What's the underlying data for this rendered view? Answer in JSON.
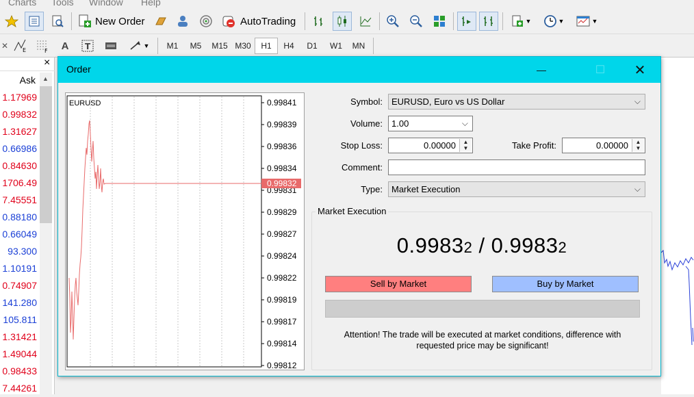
{
  "menu": {
    "items": [
      "Charts",
      "Tools",
      "Window",
      "Help"
    ]
  },
  "toolbar": {
    "new_order_label": "New Order",
    "autotrading_label": "AutoTrading",
    "timeframes": [
      "M1",
      "M5",
      "M15",
      "M30",
      "H1",
      "H4",
      "D1",
      "W1",
      "MN"
    ],
    "active_timeframe": "H1"
  },
  "market_watch": {
    "close_glyph": "×",
    "ask_header": "Ask",
    "asks": [
      {
        "value": "1.17969",
        "color": "red"
      },
      {
        "value": "0.99832",
        "color": "red"
      },
      {
        "value": "1.31627",
        "color": "red"
      },
      {
        "value": "0.66986",
        "color": "blue"
      },
      {
        "value": "0.84630",
        "color": "red"
      },
      {
        "value": "1706.49",
        "color": "red"
      },
      {
        "value": "7.45551",
        "color": "red"
      },
      {
        "value": "0.88180",
        "color": "blue"
      },
      {
        "value": "0.66049",
        "color": "blue"
      },
      {
        "value": "93.300",
        "color": "blue"
      },
      {
        "value": "1.10191",
        "color": "blue"
      },
      {
        "value": "0.74907",
        "color": "red"
      },
      {
        "value": "141.280",
        "color": "blue"
      },
      {
        "value": "105.811",
        "color": "blue"
      },
      {
        "value": "1.31421",
        "color": "red"
      },
      {
        "value": "1.49044",
        "color": "red"
      },
      {
        "value": "0.98433",
        "color": "red"
      },
      {
        "value": "7.44261",
        "color": "red"
      }
    ]
  },
  "dialog": {
    "title": "Order",
    "minimize_glyph": "—",
    "maximize_glyph": "☐",
    "close_glyph": "✕",
    "chart": {
      "symbol_label": "EURUSD",
      "price_ticks": [
        "0.99841",
        "0.99839",
        "0.99836",
        "0.99834",
        "0.99831",
        "0.99829",
        "0.99827",
        "0.99824",
        "0.99822",
        "0.99819",
        "0.99817",
        "0.99814",
        "0.99812"
      ],
      "current_price": "0.99832"
    },
    "form": {
      "symbol_label": "Symbol:",
      "symbol_value": "EURUSD, Euro vs US Dollar",
      "volume_label": "Volume:",
      "volume_value": "1.00",
      "stop_loss_label": "Stop Loss:",
      "stop_loss_value": "0.00000",
      "take_profit_label": "Take Profit:",
      "take_profit_value": "0.00000",
      "comment_label": "Comment:",
      "comment_value": "",
      "type_label": "Type:",
      "type_value": "Market Execution"
    },
    "execution": {
      "group_label": "Market Execution",
      "bid_main": "0.9983",
      "bid_small": "2",
      "separator": " / ",
      "ask_main": "0.9983",
      "ask_small": "2",
      "sell_label": "Sell by Market",
      "buy_label": "Buy by Market",
      "attention": "Attention! The trade will be executed at market conditions, difference with requested price may be significant!"
    }
  },
  "colors": {
    "title_bar": "#00d6ea",
    "sell": "#ff7f7f",
    "buy": "#9fbfff",
    "price_red": "#e0001a",
    "price_blue": "#1a3fd6"
  }
}
